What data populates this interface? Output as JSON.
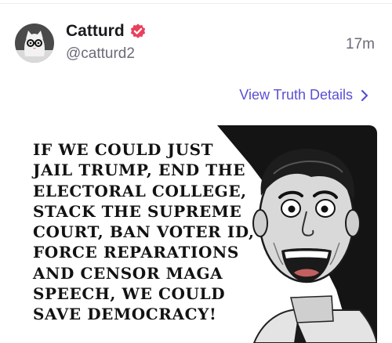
{
  "post": {
    "display_name": "Catturd",
    "handle": "@catturd2",
    "timestamp": "17m",
    "details_link": "View Truth Details",
    "avatar_icon": "cat-with-glasses-avatar",
    "verified_icon": "verified-badge-icon",
    "accent_color": "#5b4fd6",
    "verified_color": "#e8415c"
  },
  "image": {
    "icon": "vintage-man-illustration",
    "lines": [
      "IF WE COULD JUST",
      "JAIL TRUMP, END THE",
      "ELECTORAL COLLEGE,",
      "STACK THE SUPREME",
      "COURT, BAN VOTER ID,",
      "FORCE REPARATIONS",
      "AND CENSOR MAGA",
      "SPEECH, WE COULD",
      "SAVE DEMOCRACY!"
    ]
  }
}
